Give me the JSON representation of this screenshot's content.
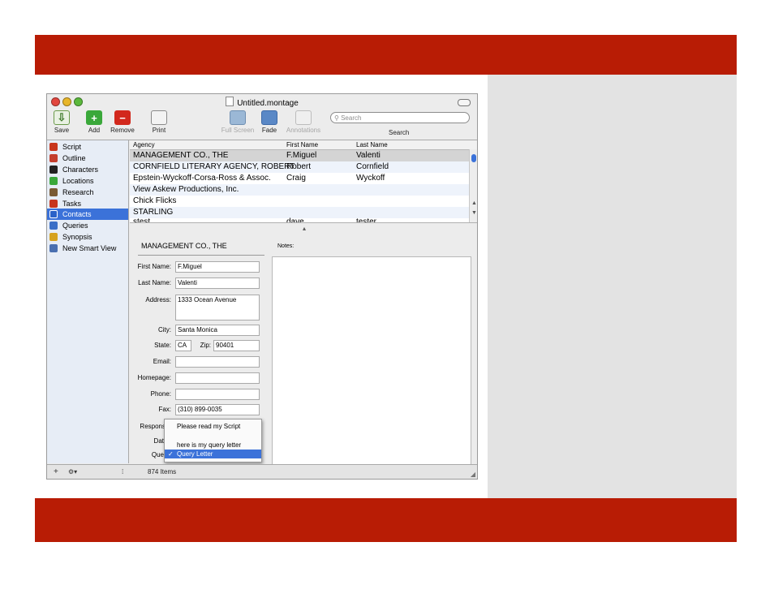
{
  "window": {
    "title": "Untitled.montage"
  },
  "toolbar": {
    "save": "Save",
    "add": "Add",
    "remove": "Remove",
    "print": "Print",
    "full_screen": "Full Screen",
    "fade": "Fade",
    "annotations": "Annotations",
    "search_placeholder": "Search",
    "search_label": "Search"
  },
  "sidebar": {
    "items": [
      {
        "label": "Script",
        "icon": "script-icon",
        "color": "#c8351c"
      },
      {
        "label": "Outline",
        "icon": "outline-icon",
        "color": "#c43e2d"
      },
      {
        "label": "Characters",
        "icon": "characters-icon",
        "color": "#222222"
      },
      {
        "label": "Locations",
        "icon": "locations-icon",
        "color": "#3aa83a"
      },
      {
        "label": "Research",
        "icon": "research-icon",
        "color": "#7a5a33"
      },
      {
        "label": "Tasks",
        "icon": "tasks-icon",
        "color": "#c8351c"
      },
      {
        "label": "Contacts",
        "icon": "contacts-icon",
        "color": "#2a62c8"
      },
      {
        "label": "Queries",
        "icon": "queries-icon",
        "color": "#3b6fc7"
      },
      {
        "label": "Synopsis",
        "icon": "synopsis-icon",
        "color": "#d6a21f"
      },
      {
        "label": "New Smart View",
        "icon": "smart-view-icon",
        "color": "#4a6fb0"
      }
    ],
    "selected": "Contacts"
  },
  "bottombar": {
    "add": "+",
    "gear": "⚙▾",
    "split": "⁞",
    "count": "874 Items"
  },
  "list": {
    "columns": [
      "Agency",
      "First Name",
      "Last Name"
    ],
    "rows": [
      [
        "MANAGEMENT CO., THE",
        "F.Miguel",
        "Valenti"
      ],
      [
        "CORNFIELD LITERARY AGENCY, ROBERT",
        "Robert",
        "Cornfield"
      ],
      [
        "Epstein-Wyckoff-Corsa-Ross & Assoc.",
        "Craig",
        "Wyckoff"
      ],
      [
        "View Askew Productions, Inc.",
        "",
        ""
      ],
      [
        "Chick Flicks",
        "",
        ""
      ],
      [
        "STARLING",
        "",
        ""
      ],
      [
        "stest",
        "dave",
        "tester"
      ]
    ]
  },
  "detail": {
    "title": "MANAGEMENT CO., THE",
    "notes_label": "Notes:",
    "labels": {
      "first_name": "First Name:",
      "last_name": "Last Name:",
      "address": "Address:",
      "city": "City:",
      "state": "State:",
      "zip": "Zip:",
      "email": "Email:",
      "homepage": "Homepage:",
      "phone": "Phone:",
      "fax": "Fax:",
      "response": "Respons",
      "date": "Dat",
      "query": "Que"
    },
    "values": {
      "first_name": "F.Miguel",
      "last_name": "Valenti",
      "address": "1333 Ocean Avenue",
      "city": "Santa Monica",
      "state": "CA",
      "zip": "90401",
      "email": "",
      "homepage": "",
      "phone": "",
      "fax": "(310) 899-0035"
    }
  },
  "popup": {
    "items": [
      "Please read my Script",
      "here is my query letter",
      "Query Letter"
    ],
    "selected": "Query Letter",
    "check": "✓"
  },
  "colors": {
    "band": "#b81c05",
    "selection": "#3b72d9"
  }
}
